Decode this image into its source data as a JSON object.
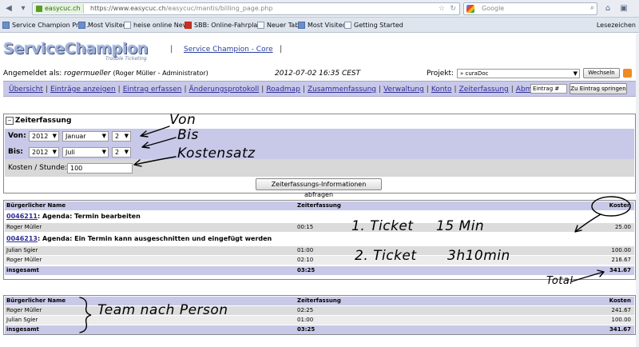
{
  "browser": {
    "url_domain": "easycuc.ch",
    "url_scheme": "https://www.",
    "url_host": "easycuc.ch",
    "url_path": "/easycuc/mantis/billing_page.php",
    "search_placeholder": "Google",
    "bookmarks": [
      {
        "label": "Service Champion Pro..."
      },
      {
        "label": "Most Visited"
      },
      {
        "label": "heise online News"
      },
      {
        "label": "SBB: Online-Fahrplan."
      },
      {
        "label": "Neuer Tab"
      },
      {
        "label": "Most Visited"
      },
      {
        "label": "Getting Started"
      }
    ],
    "bookmarks_menu": "Lesezeichen"
  },
  "header": {
    "logo": "ServiceChampion",
    "logo_tagline": "Trouble Ticketing",
    "project_link": "Service Champion - Core",
    "login_label": "Angemeldet als:",
    "login_user": "rogermueller",
    "login_fullname": "(Roger Müller - Administrator)",
    "datetime": "2012-07-02 16:35 CEST",
    "project_label": "Projekt:",
    "project_value": "» curaDoc",
    "switch_button": "Wechseln"
  },
  "menu": {
    "items": [
      "Übersicht",
      "Einträge anzeigen",
      "Eintrag erfassen",
      "Änderungsprotokoll",
      "Roadmap",
      "Zusammenfassung",
      "Verwaltung",
      "Konto",
      "Zeiterfassung",
      "Abmelden"
    ],
    "jump_placeholder": "Eintrag #",
    "jump_button": "Zu Eintrag springen"
  },
  "form": {
    "title": "Zeiterfassung",
    "von_label": "Von:",
    "bis_label": "Bis:",
    "von_year": "2012",
    "von_month": "Januar",
    "von_day": "2",
    "bis_year": "2012",
    "bis_month": "Juli",
    "bis_day": "2",
    "kosten_label": "Kosten / Stunde:",
    "kosten_value": "100",
    "submit_button": "Zeiterfassungs-Informationen abfragen"
  },
  "table_main": {
    "headers": {
      "name": "Bürgerlicher Name",
      "time": "Zeiterfassung",
      "cost": "Kosten"
    },
    "tickets": [
      {
        "id": "0046211",
        "title": ": Agenda: Termin bearbeiten",
        "rows": [
          {
            "name": "Roger Müller",
            "time": "00:15",
            "cost": "25.00"
          }
        ]
      },
      {
        "id": "0046213",
        "title": ": Agenda: Ein Termin kann ausgeschnitten und eingefügt werden",
        "rows": [
          {
            "name": "Julian Sgier",
            "time": "01:00",
            "cost": "100.00"
          },
          {
            "name": "Roger Müller",
            "time": "02:10",
            "cost": "216.67"
          }
        ]
      }
    ],
    "total": {
      "name": "insgesamt",
      "time": "03:25",
      "cost": "341.67"
    }
  },
  "table_person": {
    "headers": {
      "name": "Bürgerlicher Name",
      "time": "Zeiterfassung",
      "cost": "Kosten"
    },
    "rows": [
      {
        "name": "Roger Müller",
        "time": "02:25",
        "cost": "241.67"
      },
      {
        "name": "Julian Sgier",
        "time": "01:00",
        "cost": "100.00"
      }
    ],
    "total": {
      "name": "insgesamt",
      "time": "03:25",
      "cost": "341.67"
    }
  },
  "annotations": {
    "von": "Von",
    "bis": "Bis",
    "kostensatz": "Kostensatz",
    "ticket1": "1. Ticket",
    "ticket1_time": "15 Min",
    "ticket2": "2. Ticket",
    "ticket2_time": "3h10min",
    "total": "Total",
    "team": "Team nach Person"
  }
}
